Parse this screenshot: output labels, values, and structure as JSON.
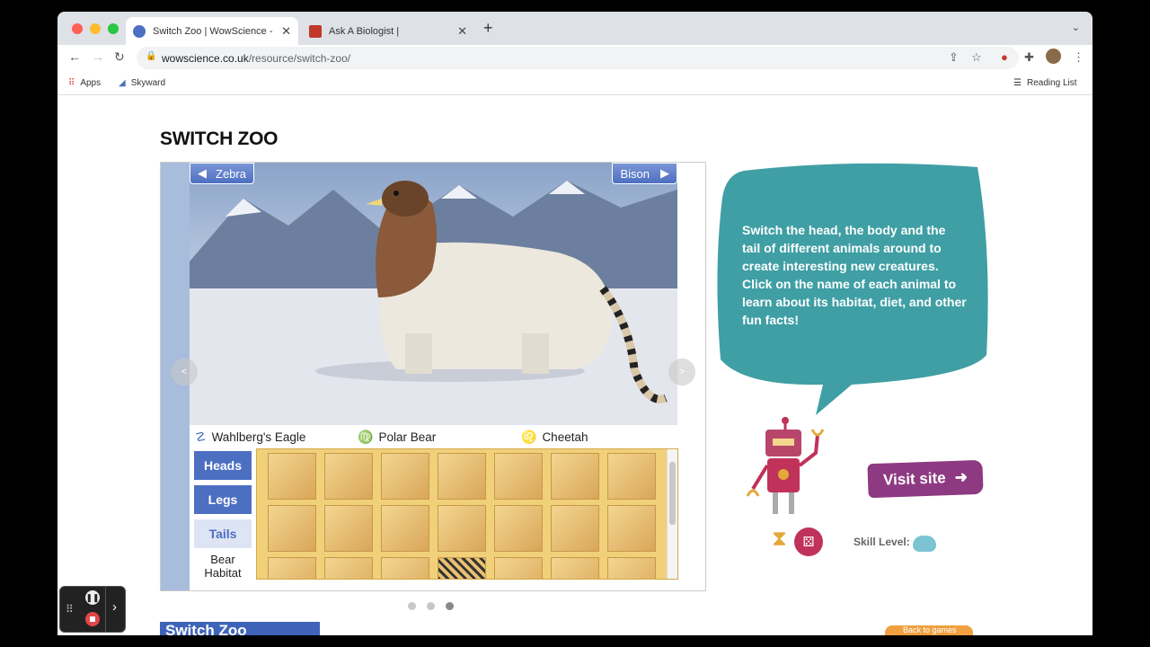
{
  "browser": {
    "tabs": [
      {
        "title": "Switch Zoo | WowScience - Sc",
        "active": true
      },
      {
        "title": "Ask A Biologist |",
        "active": false
      }
    ],
    "url_domain": "wowscience.co.uk",
    "url_path": "/resource/switch-zoo/",
    "bookmarks": [
      "Apps",
      "Skyward"
    ],
    "reading_list": "Reading List"
  },
  "page": {
    "title": "SWITCH ZOO",
    "game": {
      "prev_animal": "Zebra",
      "next_animal": "Bison",
      "head_name": "Wahlberg's Eagle",
      "body_name": "Polar Bear",
      "tail_name": "Cheetah",
      "categories": [
        "Heads",
        "Legs",
        "Tails"
      ],
      "habitat_label": "Bear Habitat",
      "prev_arrow": "<",
      "next_arrow": ">"
    },
    "description": "Switch the head, the body and the tail of different animals around to create interesting new creatures. Click on the name of each animal to learn about its habitat, diet, and other fun facts!",
    "visit_label": "Visit site",
    "skill_label": "Skill Level:",
    "banner_text": "Switch Zoo",
    "back_label": "Back to games"
  },
  "colors": {
    "accent": "#4d6fc2",
    "bubble": "#3f9fa4",
    "visit": "#8e3a82"
  }
}
